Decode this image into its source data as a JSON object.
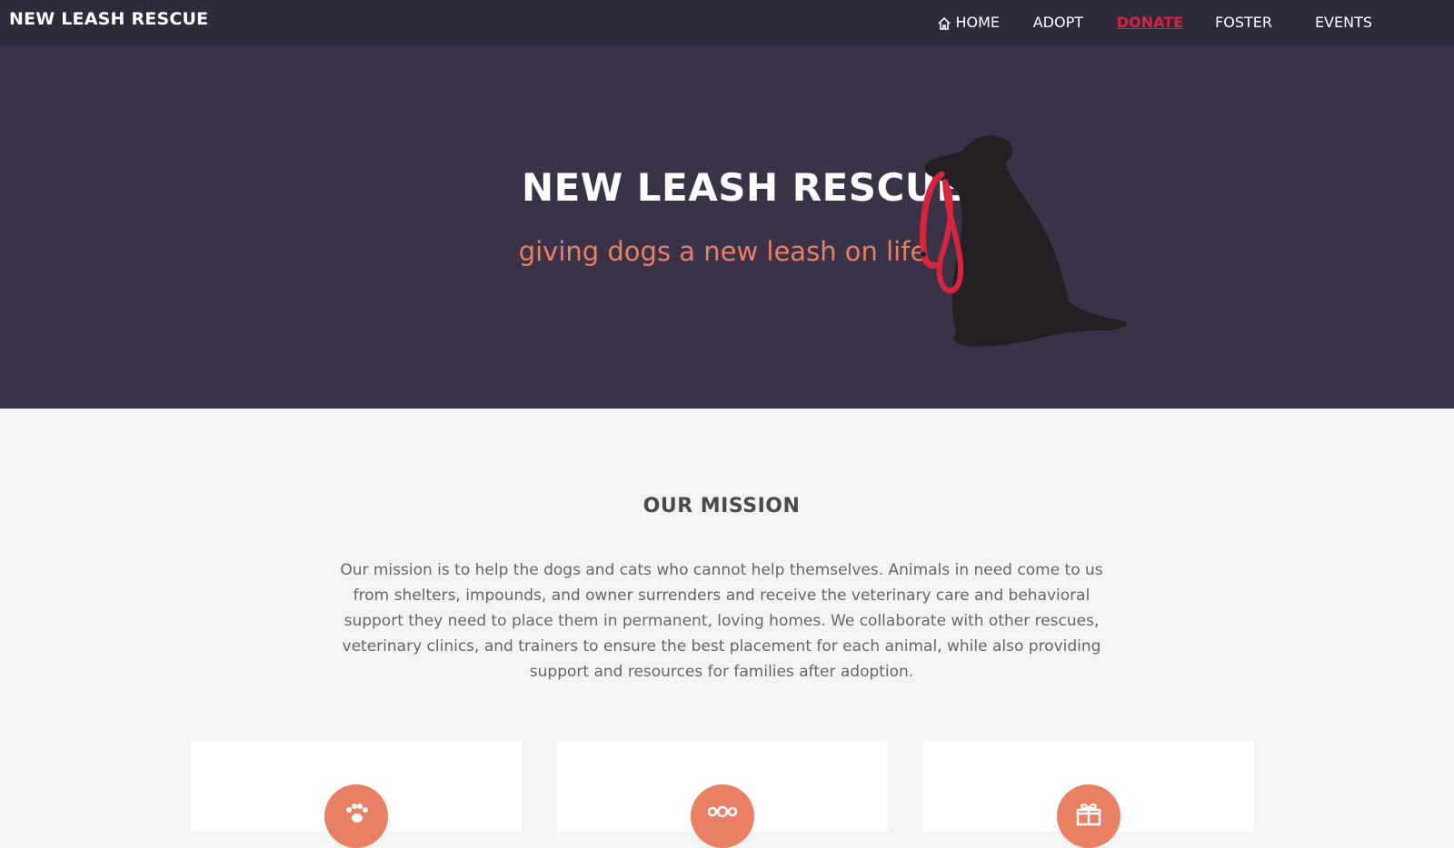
{
  "header": {
    "brand": "NEW LEASH RESCUE",
    "nav": [
      {
        "label": "HOME",
        "icon": "home-icon"
      },
      {
        "label": "ADOPT"
      },
      {
        "label": "DONATE",
        "active": true
      },
      {
        "label": "FOSTER"
      },
      {
        "label": "EVENTS"
      }
    ]
  },
  "hero": {
    "title": "NEW LEASH RESCUE",
    "subtitle": "giving dogs a new leash on life",
    "image": "dog-with-leash-silhouette"
  },
  "mission": {
    "title": "OUR MISSION",
    "text": "Our mission is to help the dogs and cats who cannot help themselves. Animals in need come to us from shelters, impounds, and owner surrenders and receive the veterinary care and behavioral support they need to place them in permanent, loving homes. We collaborate with other rescues, veterinary clinics, and trainers to ensure the best placement for each animal, while also providing support and resources for families after adoption."
  },
  "cards": [
    {
      "icon": "paw-icon"
    },
    {
      "icon": "dots-icon"
    },
    {
      "icon": "gift-icon"
    }
  ],
  "colors": {
    "nav_bg": "#2f2a3b",
    "hero_bg": "#3a3248",
    "accent": "#e98063",
    "active_link": "#d9243d",
    "page_bg": "#f4f4f4"
  }
}
